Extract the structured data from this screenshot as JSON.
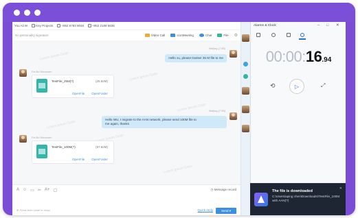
{
  "chat": {
    "top": {
      "name": "You Ali W",
      "projects": "Key Projects",
      "phone1": "+852 6783 9048",
      "phone2": "+852 2189 5836"
    },
    "signature_placeholder": "No personality signature",
    "actions": [
      {
        "label": "Video Call",
        "icon": "video-icon",
        "color": "#f0a93b"
      },
      {
        "label": "IconMeeting",
        "icon": "meeting-icon",
        "color": "#3d8fe0"
      },
      {
        "label": "Chat",
        "icon": "chat-icon",
        "color": "#3d8fe0"
      },
      {
        "label": "File",
        "icon": "folder-icon",
        "color": "#36b59a"
      }
    ],
    "watermark": "Lorem Ipsum Dolor",
    "messages": [
      {
        "meta": "Beijing (7:59)",
        "text": "Hello xu, please transer 25 M file to me"
      },
      {
        "meta": "Fei Bo Wenchen",
        "file_name": "TestFile_25M(?)",
        "file_size": "(25.82M)",
        "open_file": "OpenFile",
        "open_folder": "OpenFolder"
      },
      {
        "meta": "Beijing (7:59)",
        "text_line1": "Hello WU, I migrate to the AAN network, please send 100M file to",
        "text_line2": "me again, thanks"
      },
      {
        "meta": "Fei Bo Wenchen",
        "file_name": "TestFile_100M(?)",
        "file_size": "(97.82M)",
        "open_file": "OpenFile",
        "open_folder": "OpenFolder"
      }
    ],
    "composer": {
      "tools": [
        "A",
        "☺",
        "▭",
        "✂",
        "A+",
        "▢"
      ],
      "message_record": "Message record",
      "hint": "Press both close to rmap",
      "shortcut": "Quick reply",
      "send": "Send ▾"
    }
  },
  "clock": {
    "title": "Alarms & Clock",
    "window_controls": [
      "–",
      "□",
      "✕"
    ],
    "timer_dim": "00:00:",
    "timer_strong": "16",
    "timer_ms": ".94",
    "bottom_icons": [
      "⊟",
      "⇄",
      "⋯"
    ]
  },
  "toast": {
    "title": "The file is downloaded",
    "body": "C:\\Users\\aping chen\\Downloads\\\\TestFile_100M with AAN(?)",
    "close": "✕"
  }
}
